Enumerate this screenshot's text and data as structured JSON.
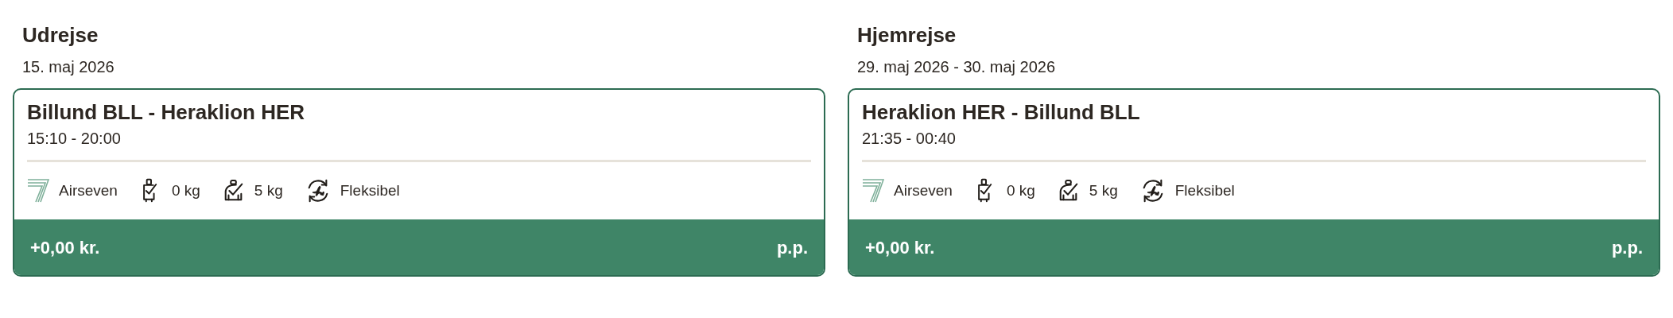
{
  "legs": [
    {
      "heading": "Udrejse",
      "date": "15. maj 2026",
      "route": "Billund BLL - Heraklion HER",
      "times": "15:10 - 20:00",
      "airline": "Airseven",
      "features": [
        {
          "kind": "cabin",
          "label": "0 kg"
        },
        {
          "kind": "personal",
          "label": "5 kg"
        },
        {
          "kind": "flex",
          "label": "Fleksibel"
        }
      ],
      "price": "+0,00 kr.",
      "unit": "p.p."
    },
    {
      "heading": "Hjemrejse",
      "date": "29. maj 2026 - 30. maj 2026",
      "route": "Heraklion HER - Billund BLL",
      "times": "21:35 - 00:40",
      "airline": "Airseven",
      "features": [
        {
          "kind": "cabin",
          "label": "0 kg"
        },
        {
          "kind": "personal",
          "label": "5 kg"
        },
        {
          "kind": "flex",
          "label": "Fleksibel"
        }
      ],
      "price": "+0,00 kr.",
      "unit": "p.p."
    }
  ]
}
